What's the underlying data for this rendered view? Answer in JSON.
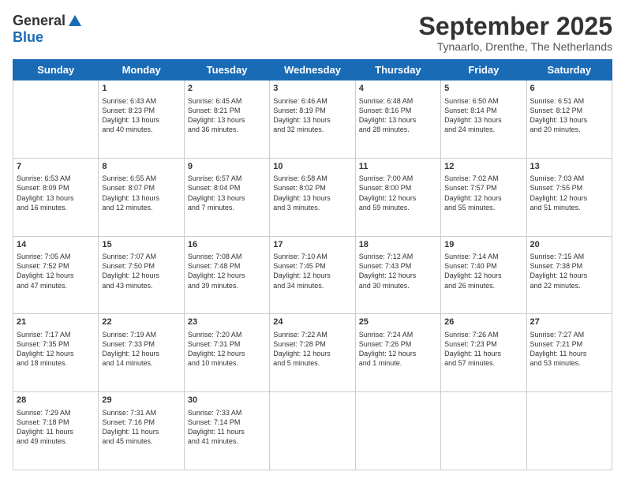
{
  "logo": {
    "general": "General",
    "blue": "Blue"
  },
  "title": "September 2025",
  "location": "Tynaarlo, Drenthe, The Netherlands",
  "days_header": [
    "Sunday",
    "Monday",
    "Tuesday",
    "Wednesday",
    "Thursday",
    "Friday",
    "Saturday"
  ],
  "weeks": [
    [
      {
        "day": "",
        "info": ""
      },
      {
        "day": "1",
        "info": "Sunrise: 6:43 AM\nSunset: 8:23 PM\nDaylight: 13 hours\nand 40 minutes."
      },
      {
        "day": "2",
        "info": "Sunrise: 6:45 AM\nSunset: 8:21 PM\nDaylight: 13 hours\nand 36 minutes."
      },
      {
        "day": "3",
        "info": "Sunrise: 6:46 AM\nSunset: 8:19 PM\nDaylight: 13 hours\nand 32 minutes."
      },
      {
        "day": "4",
        "info": "Sunrise: 6:48 AM\nSunset: 8:16 PM\nDaylight: 13 hours\nand 28 minutes."
      },
      {
        "day": "5",
        "info": "Sunrise: 6:50 AM\nSunset: 8:14 PM\nDaylight: 13 hours\nand 24 minutes."
      },
      {
        "day": "6",
        "info": "Sunrise: 6:51 AM\nSunset: 8:12 PM\nDaylight: 13 hours\nand 20 minutes."
      }
    ],
    [
      {
        "day": "7",
        "info": "Sunrise: 6:53 AM\nSunset: 8:09 PM\nDaylight: 13 hours\nand 16 minutes."
      },
      {
        "day": "8",
        "info": "Sunrise: 6:55 AM\nSunset: 8:07 PM\nDaylight: 13 hours\nand 12 minutes."
      },
      {
        "day": "9",
        "info": "Sunrise: 6:57 AM\nSunset: 8:04 PM\nDaylight: 13 hours\nand 7 minutes."
      },
      {
        "day": "10",
        "info": "Sunrise: 6:58 AM\nSunset: 8:02 PM\nDaylight: 13 hours\nand 3 minutes."
      },
      {
        "day": "11",
        "info": "Sunrise: 7:00 AM\nSunset: 8:00 PM\nDaylight: 12 hours\nand 59 minutes."
      },
      {
        "day": "12",
        "info": "Sunrise: 7:02 AM\nSunset: 7:57 PM\nDaylight: 12 hours\nand 55 minutes."
      },
      {
        "day": "13",
        "info": "Sunrise: 7:03 AM\nSunset: 7:55 PM\nDaylight: 12 hours\nand 51 minutes."
      }
    ],
    [
      {
        "day": "14",
        "info": "Sunrise: 7:05 AM\nSunset: 7:52 PM\nDaylight: 12 hours\nand 47 minutes."
      },
      {
        "day": "15",
        "info": "Sunrise: 7:07 AM\nSunset: 7:50 PM\nDaylight: 12 hours\nand 43 minutes."
      },
      {
        "day": "16",
        "info": "Sunrise: 7:08 AM\nSunset: 7:48 PM\nDaylight: 12 hours\nand 39 minutes."
      },
      {
        "day": "17",
        "info": "Sunrise: 7:10 AM\nSunset: 7:45 PM\nDaylight: 12 hours\nand 34 minutes."
      },
      {
        "day": "18",
        "info": "Sunrise: 7:12 AM\nSunset: 7:43 PM\nDaylight: 12 hours\nand 30 minutes."
      },
      {
        "day": "19",
        "info": "Sunrise: 7:14 AM\nSunset: 7:40 PM\nDaylight: 12 hours\nand 26 minutes."
      },
      {
        "day": "20",
        "info": "Sunrise: 7:15 AM\nSunset: 7:38 PM\nDaylight: 12 hours\nand 22 minutes."
      }
    ],
    [
      {
        "day": "21",
        "info": "Sunrise: 7:17 AM\nSunset: 7:35 PM\nDaylight: 12 hours\nand 18 minutes."
      },
      {
        "day": "22",
        "info": "Sunrise: 7:19 AM\nSunset: 7:33 PM\nDaylight: 12 hours\nand 14 minutes."
      },
      {
        "day": "23",
        "info": "Sunrise: 7:20 AM\nSunset: 7:31 PM\nDaylight: 12 hours\nand 10 minutes."
      },
      {
        "day": "24",
        "info": "Sunrise: 7:22 AM\nSunset: 7:28 PM\nDaylight: 12 hours\nand 5 minutes."
      },
      {
        "day": "25",
        "info": "Sunrise: 7:24 AM\nSunset: 7:26 PM\nDaylight: 12 hours\nand 1 minute."
      },
      {
        "day": "26",
        "info": "Sunrise: 7:26 AM\nSunset: 7:23 PM\nDaylight: 11 hours\nand 57 minutes."
      },
      {
        "day": "27",
        "info": "Sunrise: 7:27 AM\nSunset: 7:21 PM\nDaylight: 11 hours\nand 53 minutes."
      }
    ],
    [
      {
        "day": "28",
        "info": "Sunrise: 7:29 AM\nSunset: 7:18 PM\nDaylight: 11 hours\nand 49 minutes."
      },
      {
        "day": "29",
        "info": "Sunrise: 7:31 AM\nSunset: 7:16 PM\nDaylight: 11 hours\nand 45 minutes."
      },
      {
        "day": "30",
        "info": "Sunrise: 7:33 AM\nSunset: 7:14 PM\nDaylight: 11 hours\nand 41 minutes."
      },
      {
        "day": "",
        "info": ""
      },
      {
        "day": "",
        "info": ""
      },
      {
        "day": "",
        "info": ""
      },
      {
        "day": "",
        "info": ""
      }
    ]
  ]
}
